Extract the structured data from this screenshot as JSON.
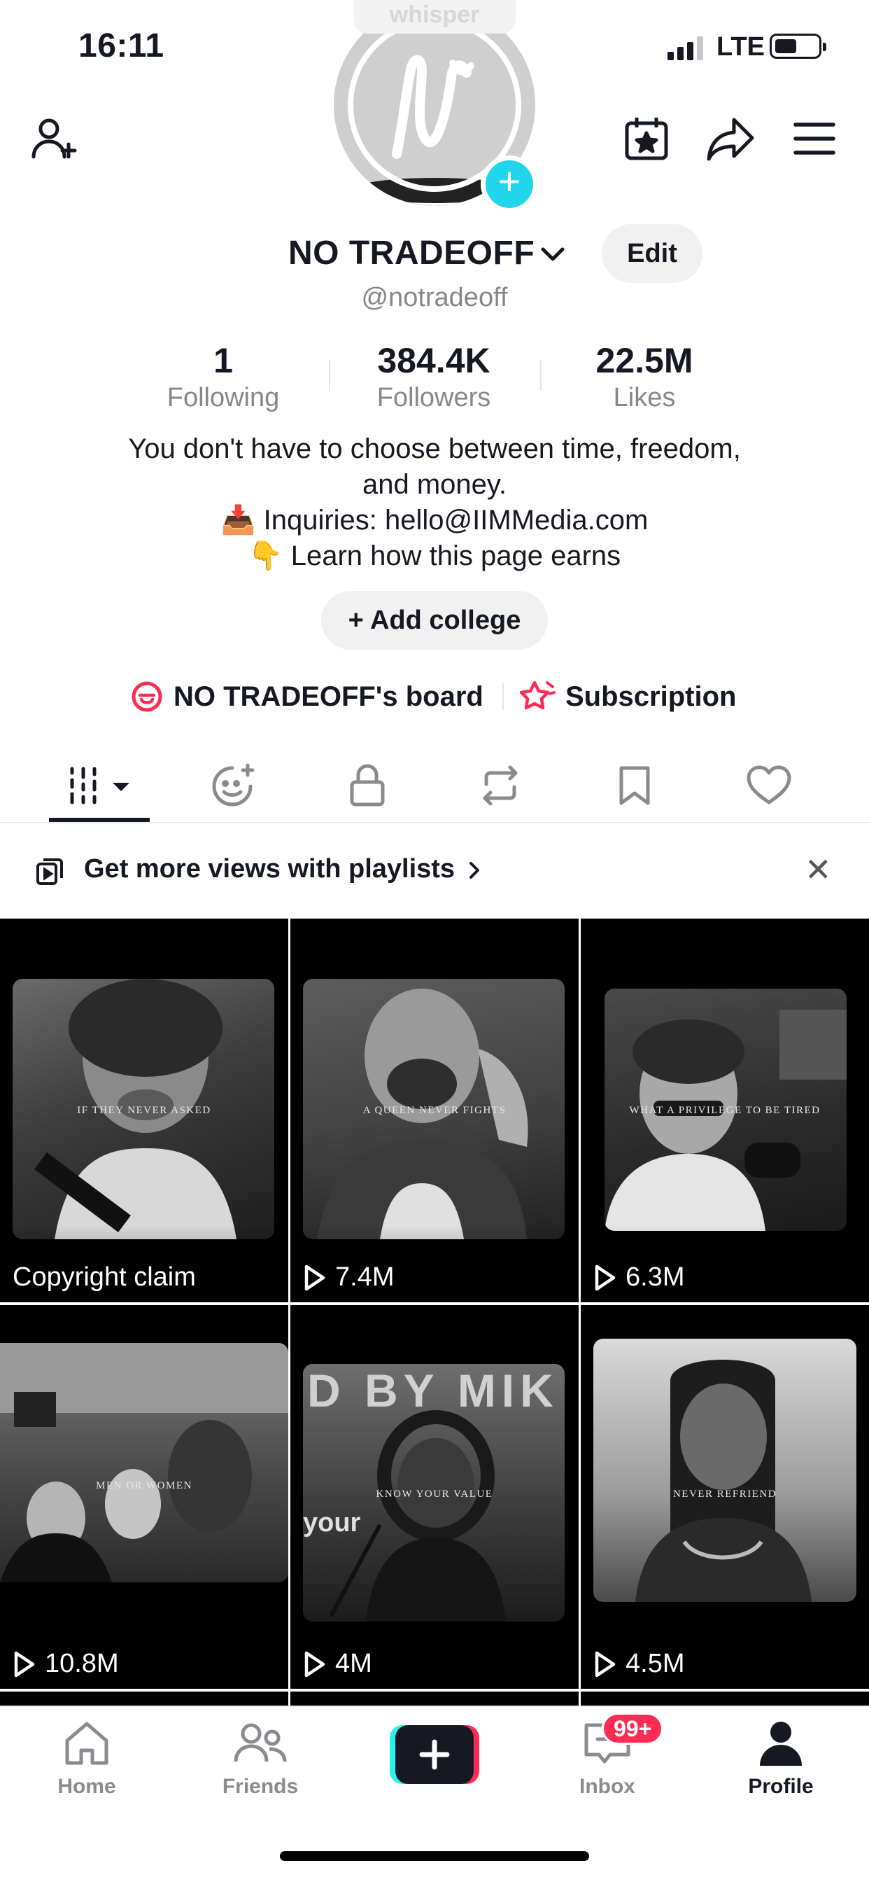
{
  "status": {
    "time": "16:11",
    "network": "LTE"
  },
  "profile": {
    "whisper_label": "whisper",
    "username": "NO TRADEOFF",
    "edit_label": "Edit",
    "handle": "@notradeoff",
    "stats": [
      {
        "value": "1",
        "label": "Following"
      },
      {
        "value": "384.4K",
        "label": "Followers"
      },
      {
        "value": "22.5M",
        "label": "Likes"
      }
    ],
    "bio": [
      "You don't have to choose between time, freedom,",
      "and money.",
      "📥 Inquiries: hello@IIMMedia.com",
      "👇 Learn how this page earns"
    ],
    "college_label": "+ Add college",
    "board_label": "NO TRADEOFF's board",
    "subscription_label": "Subscription"
  },
  "tabs": [
    "videos",
    "favorites-face",
    "private",
    "reposts",
    "saved",
    "liked"
  ],
  "playlist_banner": {
    "text": "Get more views with playlists"
  },
  "videos": [
    {
      "caption": "IF THEY NEVER ASKED",
      "footer": "Copyright claim"
    },
    {
      "caption": "A QUEEN NEVER FIGHTS",
      "footer": "7.4M"
    },
    {
      "caption": "WHAT A PRIVILEGE TO BE TIRED",
      "footer": "6.3M"
    },
    {
      "caption": "MEN OR WOMEN",
      "footer": "10.8M"
    },
    {
      "caption": "KNOW YOUR VALUE",
      "footer": "4M",
      "overlay_top": "D BY MIK",
      "overlay_side": "your"
    },
    {
      "caption": "NEVER REFRIEND",
      "footer": "4.5M"
    }
  ],
  "nav": {
    "home": "Home",
    "friends": "Friends",
    "inbox": "Inbox",
    "inbox_badge": "99+",
    "profile": "Profile"
  },
  "colors": {
    "accent": "#fe2c55",
    "teal": "#20d5ec",
    "text": "#161823",
    "muted": "#86878b"
  }
}
